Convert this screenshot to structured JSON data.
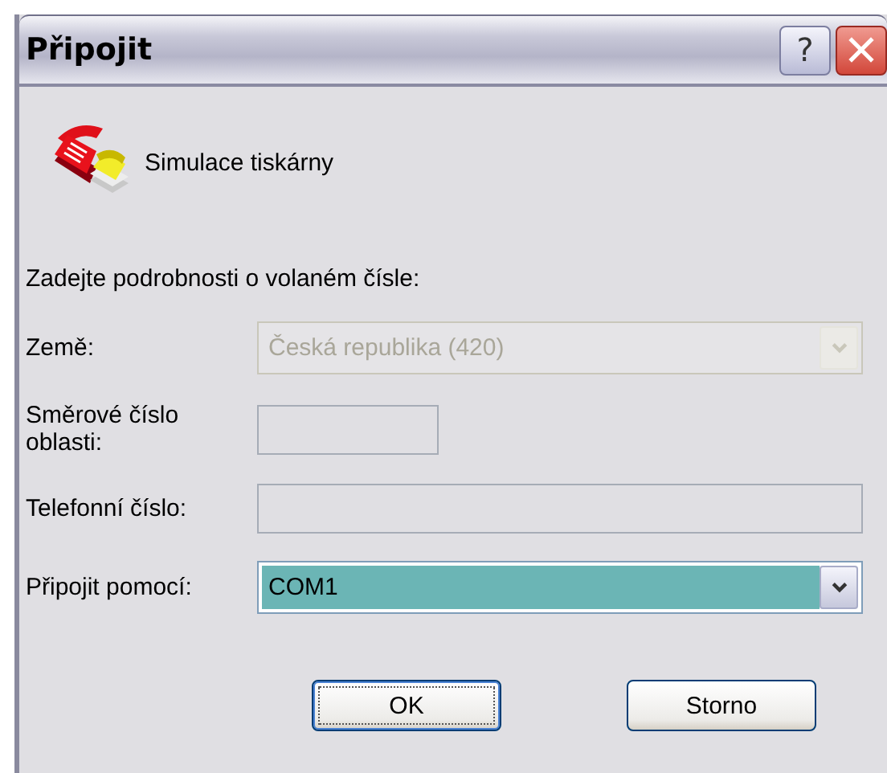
{
  "window": {
    "title": "Připojit",
    "help_button": "?"
  },
  "connection": {
    "name": "Simulace tiskárny"
  },
  "prompt": "Zadejte podrobnosti o volaném čísle:",
  "fields": [
    {
      "kind": "combo",
      "label": "Země:",
      "value": "Česká republika (420)",
      "disabled": true,
      "focused": false
    },
    {
      "kind": "text",
      "label": "Směrové číslo oblasti:",
      "disabled": true,
      "focused": false
    },
    {
      "kind": "text",
      "label": "Telefonní číslo:",
      "disabled": true,
      "focused": false
    },
    {
      "kind": "combo",
      "label": "Připojit pomocí:",
      "value": "COM1",
      "disabled": false,
      "focused": true
    }
  ],
  "buttons": [
    {
      "label": "OK",
      "focused": true
    },
    {
      "label": "Storno",
      "focused": false
    }
  ]
}
